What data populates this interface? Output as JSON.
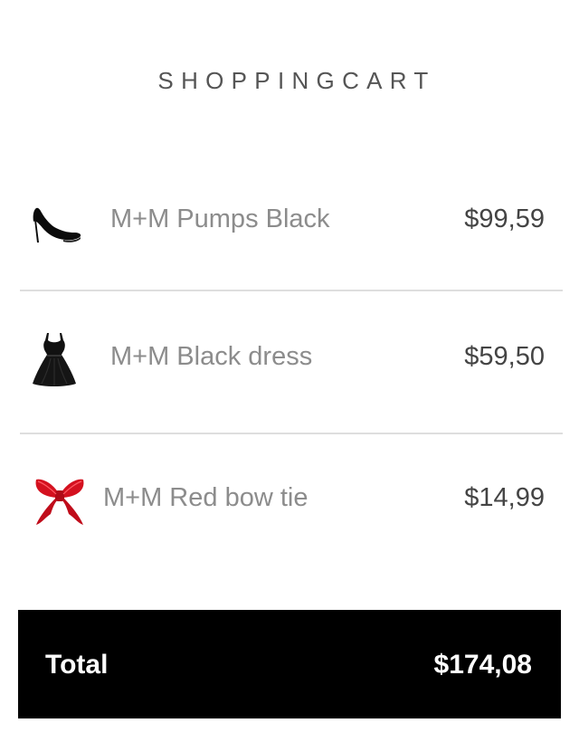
{
  "header": {
    "title": "SHOPPINGCART"
  },
  "cart": {
    "items": [
      {
        "name": "M+M Pumps Black",
        "price": "$99,59",
        "icon": "black-pump-shoe-icon"
      },
      {
        "name": "M+M Black dress",
        "price": "$59,50",
        "icon": "black-dress-icon"
      },
      {
        "name": "M+M Red bow tie",
        "price": "$14,99",
        "icon": "red-bow-tie-icon"
      }
    ]
  },
  "total": {
    "label": "Total",
    "value": "$174,08"
  },
  "colors": {
    "title": "#555555",
    "item_name": "#8c8c8c",
    "item_price": "#444444",
    "divider": "#dedede",
    "total_background": "#000000",
    "total_text": "#ffffff",
    "bow_tie_red": "#d4111f"
  }
}
